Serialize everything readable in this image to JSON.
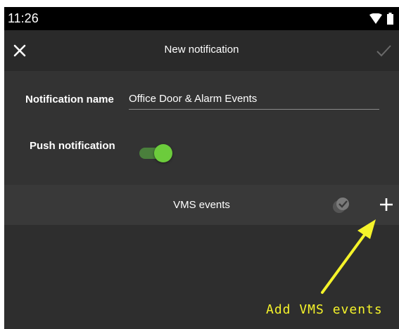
{
  "status_bar": {
    "time": "11:26"
  },
  "app_bar": {
    "title": "New notification"
  },
  "form": {
    "name_label": "Notification name",
    "name_value": "Office Door & Alarm Events",
    "push_label": "Push notification",
    "push_enabled": true
  },
  "vms": {
    "title": "VMS events"
  },
  "annotation": {
    "text": "Add VMS events"
  },
  "colors": {
    "background": "#2e2e2e",
    "toggle_on": "#6ccc3c",
    "annotation": "#f5f32a"
  }
}
